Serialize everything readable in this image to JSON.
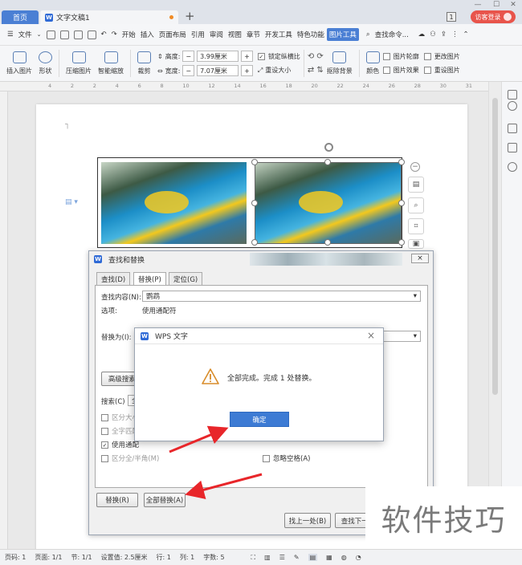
{
  "titlebar": {
    "home_tab": "首页",
    "doc_tab": "文字文稿1",
    "new_tab": "+",
    "badge": "1",
    "guest": "访客登录"
  },
  "menubar": {
    "file": "文件",
    "items": [
      "开始",
      "插入",
      "页面布局",
      "引用",
      "审阅",
      "视图",
      "章节",
      "开发工具",
      "特色功能"
    ],
    "active": "图片工具",
    "search": "查找命令..."
  },
  "ribbon": {
    "insert_pic": "插入图片",
    "shape": "形状",
    "compress": "压缩图片",
    "smart_zoom": "智能缩放",
    "crop": "裁剪",
    "height_label": "高度:",
    "height_value": "3.99厘米",
    "width_label": "宽度:",
    "width_value": "7.07厘米",
    "lock_ratio": "锁定纵横比",
    "reset_size": "重设大小",
    "cutout": "抠除背景",
    "color": "颜色",
    "outline": "图片轮廓",
    "effects": "图片效果",
    "change_pic": "更改图片",
    "reset_pic": "重设图片"
  },
  "ruler": {
    "ticks": [
      "4",
      "2",
      "2",
      "4",
      "6",
      "8",
      "10",
      "12",
      "14",
      "16",
      "18",
      "20",
      "22",
      "24",
      "26",
      "28",
      "30",
      "31"
    ]
  },
  "dialog": {
    "title": "查找和替换",
    "close": "×",
    "tabs": [
      "查找(D)",
      "替换(P)",
      "定位(G)"
    ],
    "find_label": "查找内容(N):",
    "find_value": "鹦鹉",
    "options_label": "选项:",
    "options_value": "使用通配符",
    "replace_label": "替换为(I):",
    "advanced": "高级搜索(",
    "search_label": "搜索(C)",
    "search_value": "全",
    "checks": [
      "区分大小",
      "全字匹配",
      "使用通配",
      "区分全/半角(M)"
    ],
    "ignore_space": "忽略空格(A)",
    "replace_btn": "替换(R)",
    "replace_all_btn": "全部替换(A)",
    "find_prev": "找上一处(B)",
    "find_next": "查找下一处"
  },
  "msgbox": {
    "title": "WPS 文字",
    "message": "全部完成。完成 1 处替换。",
    "ok": "确定",
    "close": "×"
  },
  "status": {
    "page": "页码: 1",
    "pages": "页面: 1/1",
    "section": "节: 1/1",
    "setting": "设置值: 2.5厘米",
    "row": "行: 1",
    "col": "列: 1",
    "words": "字数: 5"
  },
  "watermark": "软件技巧"
}
